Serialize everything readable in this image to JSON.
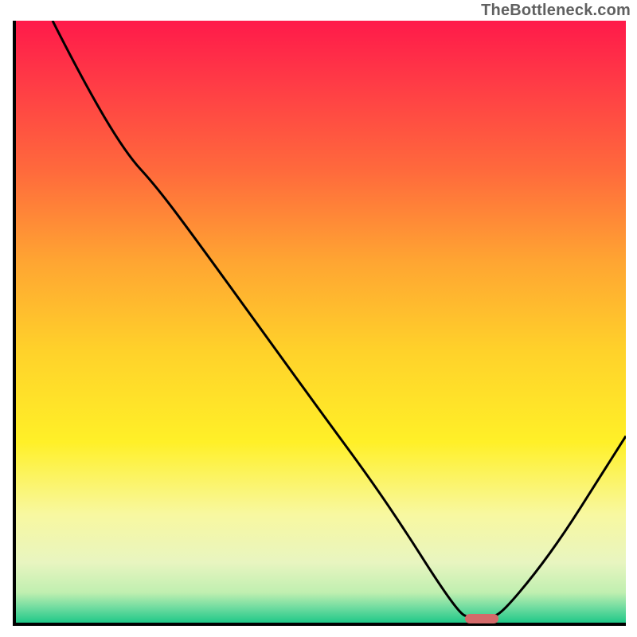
{
  "watermark": "TheBottleneck.com",
  "chart_data": {
    "type": "line",
    "title": "",
    "xlabel": "",
    "ylabel": "",
    "x_range": [
      0,
      100
    ],
    "y_range": [
      0,
      100
    ],
    "background_gradient_stops": [
      {
        "offset": 0.0,
        "color": "#ff1a4a"
      },
      {
        "offset": 0.1,
        "color": "#ff3a46"
      },
      {
        "offset": 0.25,
        "color": "#ff6a3c"
      },
      {
        "offset": 0.4,
        "color": "#ffa532"
      },
      {
        "offset": 0.55,
        "color": "#ffd22a"
      },
      {
        "offset": 0.7,
        "color": "#fff028"
      },
      {
        "offset": 0.82,
        "color": "#f8f8a0"
      },
      {
        "offset": 0.9,
        "color": "#e8f5c0"
      },
      {
        "offset": 0.95,
        "color": "#c0efb0"
      },
      {
        "offset": 0.975,
        "color": "#70dca0"
      },
      {
        "offset": 1.0,
        "color": "#20c888"
      }
    ],
    "series": [
      {
        "name": "bottleneck-curve",
        "color": "#000000",
        "points": [
          {
            "x": 6.0,
            "y": 100.0
          },
          {
            "x": 11.0,
            "y": 90.0
          },
          {
            "x": 18.0,
            "y": 78.0
          },
          {
            "x": 23.0,
            "y": 72.5
          },
          {
            "x": 30.0,
            "y": 63.0
          },
          {
            "x": 40.0,
            "y": 49.0
          },
          {
            "x": 50.0,
            "y": 35.0
          },
          {
            "x": 58.0,
            "y": 24.0
          },
          {
            "x": 64.0,
            "y": 15.0
          },
          {
            "x": 69.0,
            "y": 7.0
          },
          {
            "x": 72.5,
            "y": 2.0
          },
          {
            "x": 74.0,
            "y": 0.8
          },
          {
            "x": 78.0,
            "y": 0.8
          },
          {
            "x": 80.0,
            "y": 2.0
          },
          {
            "x": 85.0,
            "y": 8.0
          },
          {
            "x": 90.0,
            "y": 15.0
          },
          {
            "x": 95.0,
            "y": 23.0
          },
          {
            "x": 100.0,
            "y": 31.0
          }
        ]
      }
    ],
    "marker": {
      "x": 76.0,
      "y": 1.2,
      "color": "#d46a6a"
    }
  }
}
